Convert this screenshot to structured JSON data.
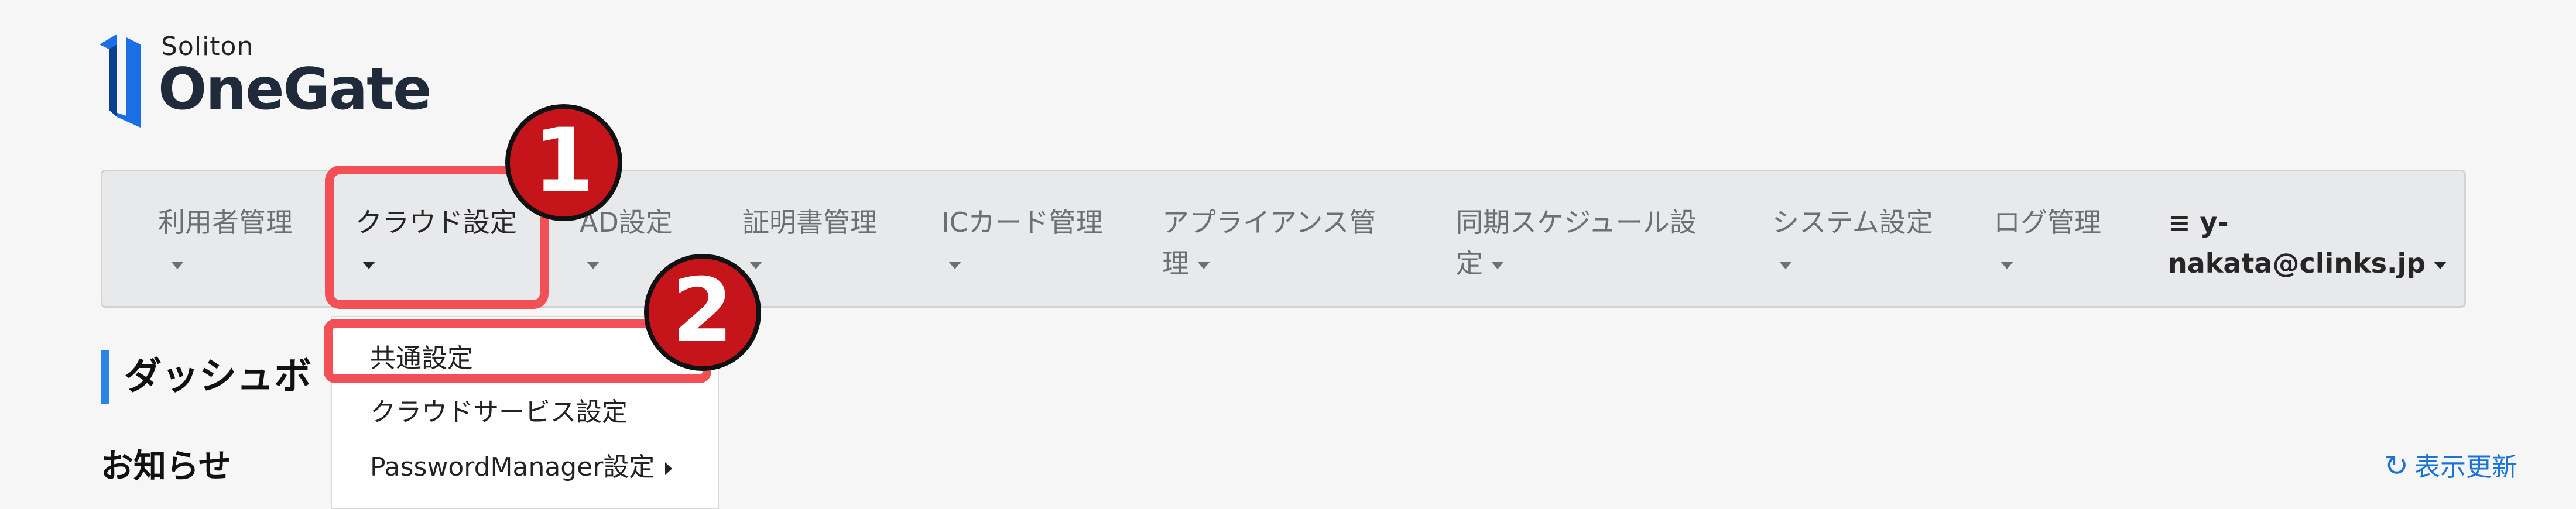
{
  "logo": {
    "small_text": "Soliton",
    "big_text": "OneGate",
    "brand_color": "#1a6fe6"
  },
  "nav": {
    "items": [
      {
        "label": "利用者管理"
      },
      {
        "label": "クラウド設定"
      },
      {
        "label": "AD設定"
      },
      {
        "label": "証明書管理"
      },
      {
        "label": "ICカード管理"
      },
      {
        "label_line1": "アプライアンス管",
        "label_line2": "理"
      },
      {
        "label_line1": "同期スケジュール設",
        "label_line2": "定"
      },
      {
        "label": "システム設定"
      },
      {
        "label": "ログ管理"
      },
      {
        "label_line1": "≡ y-",
        "label_line2": "nakata@clinks.jp"
      }
    ]
  },
  "dropdown": {
    "items": [
      {
        "label": "共通設定"
      },
      {
        "label": "クラウドサービス設定"
      },
      {
        "label": "PasswordManager設定"
      }
    ]
  },
  "annotations": {
    "badge1": "1",
    "badge2": "2",
    "highlight_color": "#f25056",
    "badge_color": "#c5151b"
  },
  "page": {
    "title": "ダッシュボ",
    "notice_heading": "お知らせ",
    "refresh_label": "表示更新",
    "accent_color": "#2a83e6",
    "link_color": "#1a73d8"
  }
}
